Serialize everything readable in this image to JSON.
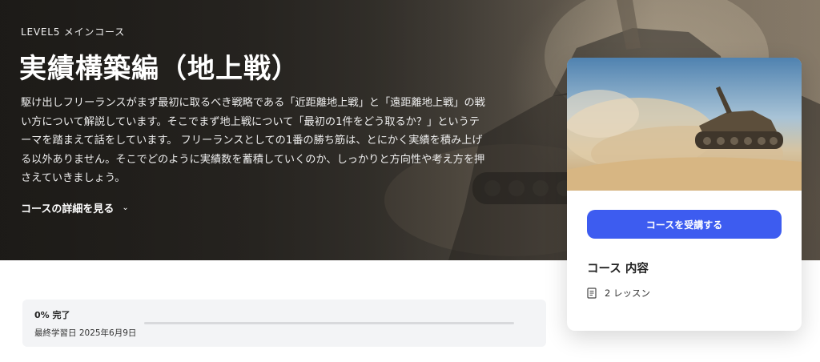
{
  "hero": {
    "eyebrow": "LEVEL5 メインコース",
    "title": "実績構築編（地上戦）",
    "description": "駆け出しフリーランスがまず最初に取るべき戦略である「近距離地上戦」と「遠距離地上戦」の戦い方について解説しています。そこでまず地上戦について「最初の1件をどう取るか？」というテーマを踏まえて話をしています。 フリーランスとしての1番の勝ち筋は、とにかく実績を積み上げる以外ありません。そこでどのように実績数を蓄積していくのか、しっかりと方向性や考え方を押さえていきましょう。",
    "details_label": "コースの詳細を見る",
    "details_icon": "chevron-down-icon"
  },
  "progress": {
    "percent_label": "0% 完了",
    "percent": 0,
    "last_study_label": "最終学習日 2025年6月9日"
  },
  "course_card": {
    "enroll_label": "コースを受講する",
    "content_heading": "コース 内容",
    "lesson_icon": "book-icon",
    "lesson_count_label": "2 レッスン"
  },
  "colors": {
    "accent": "#3d5cf0",
    "progress_track": "#d8d9dc",
    "progress_card_bg": "#f3f4f6"
  }
}
